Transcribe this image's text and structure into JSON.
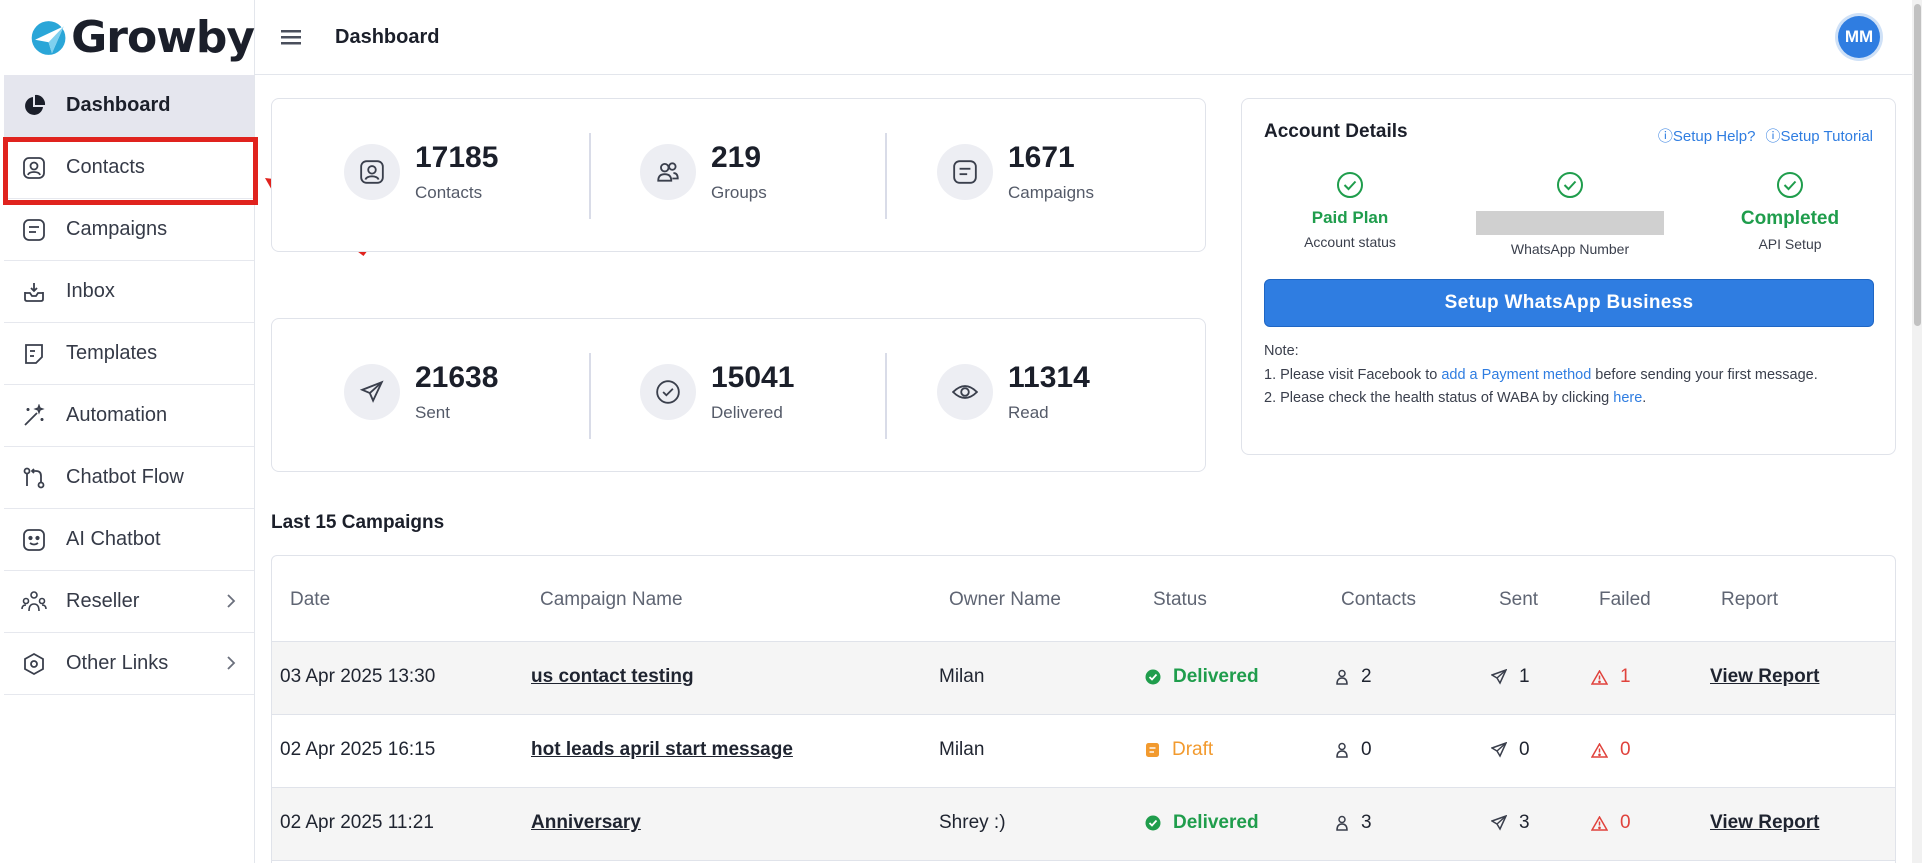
{
  "brand": {
    "name": "Growby"
  },
  "header": {
    "title": "Dashboard",
    "avatar_initials": "MM"
  },
  "sidebar": {
    "items": [
      {
        "label": "Dashboard",
        "icon": "pie-chart-icon",
        "active": true
      },
      {
        "label": "Contacts",
        "icon": "contact-icon"
      },
      {
        "label": "Campaigns",
        "icon": "campaign-icon"
      },
      {
        "label": "Inbox",
        "icon": "inbox-icon"
      },
      {
        "label": "Templates",
        "icon": "template-icon"
      },
      {
        "label": "Automation",
        "icon": "magic-wand-icon"
      },
      {
        "label": "Chatbot Flow",
        "icon": "flow-icon"
      },
      {
        "label": "AI Chatbot",
        "icon": "bot-icon"
      },
      {
        "label": "Reseller",
        "icon": "reseller-icon",
        "has_submenu": true
      },
      {
        "label": "Other Links",
        "icon": "hexagon-icon",
        "has_submenu": true
      }
    ]
  },
  "stats_top": [
    {
      "value": "17185",
      "label": "Contacts",
      "icon": "contact-icon"
    },
    {
      "value": "219",
      "label": "Groups",
      "icon": "groups-icon"
    },
    {
      "value": "1671",
      "label": "Campaigns",
      "icon": "campaign-icon"
    }
  ],
  "stats_bottom": [
    {
      "value": "21638",
      "label": "Sent",
      "icon": "send-icon"
    },
    {
      "value": "15041",
      "label": "Delivered",
      "icon": "check-circle-icon"
    },
    {
      "value": "11314",
      "label": "Read",
      "icon": "eye-icon"
    }
  ],
  "account": {
    "title": "Account Details",
    "setup_help": "ⓘSetup Help?",
    "setup_tutorial": "ⓘSetup Tutorial",
    "plan_value": "Paid Plan",
    "plan_label": "Account status",
    "number_label": "WhatsApp Number",
    "api_value": "Completed",
    "api_label": "API Setup",
    "button": "Setup WhatsApp Business",
    "note_title": "Note:",
    "note1_pre": "1. Please visit Facebook to ",
    "note1_link": "add a Payment method",
    "note1_post": " before sending your first message.",
    "note2_pre": "2. Please check the health status of WABA by clicking ",
    "note2_link": "here",
    "note2_post": "."
  },
  "campaigns": {
    "title": "Last 15 Campaigns",
    "columns": [
      "Date",
      "Campaign Name",
      "Owner Name",
      "Status",
      "Contacts",
      "Sent",
      "Failed",
      "Report"
    ],
    "rows": [
      {
        "date": "03 Apr 2025 13:30",
        "name": "us contact testing",
        "owner": "Milan",
        "status": "Delivered",
        "contacts": "2",
        "sent": "1",
        "failed": "1",
        "report": "View Report"
      },
      {
        "date": "02 Apr 2025 16:15",
        "name": "hot leads april start message",
        "owner": "Milan",
        "status": "Draft",
        "contacts": "0",
        "sent": "0",
        "failed": "0",
        "report": ""
      },
      {
        "date": "02 Apr 2025 11:21",
        "name": "Anniversary",
        "owner": "Shrey :)",
        "status": "Delivered",
        "contacts": "3",
        "sent": "3",
        "failed": "0",
        "report": "View Report"
      }
    ]
  },
  "colors": {
    "accent": "#2f7de1",
    "success": "#1f9d4c",
    "draft": "#f29a2e",
    "danger": "#e0423c",
    "highlight": "#e0231e"
  }
}
